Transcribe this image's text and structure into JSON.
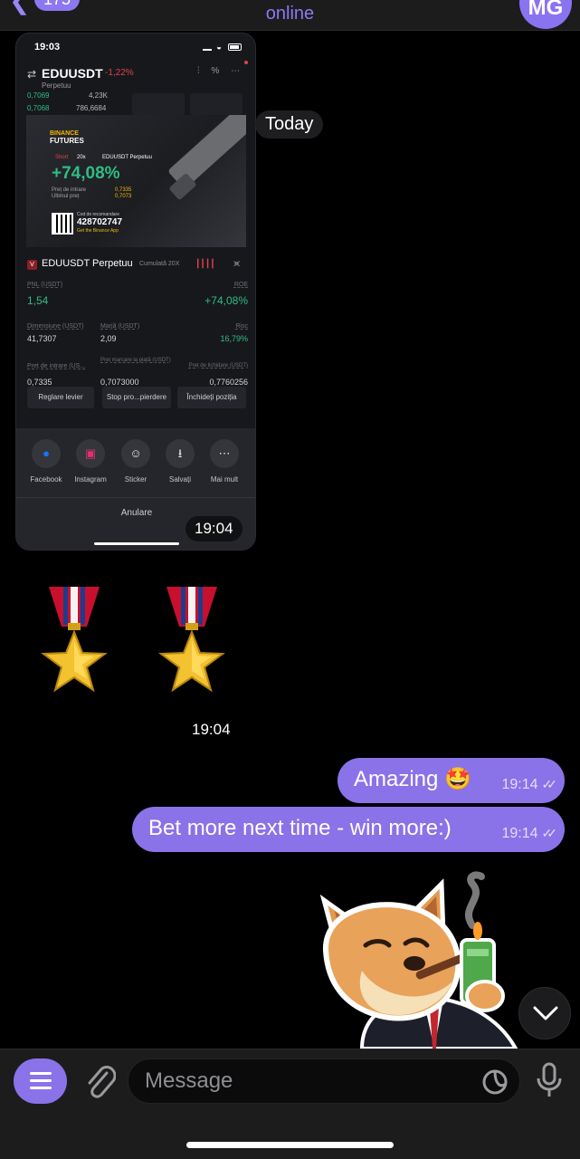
{
  "header": {
    "back_badge": "175",
    "status": "online",
    "avatar_initials": "MG"
  },
  "date_divider": "Today",
  "photo_message": {
    "time": "19:04",
    "screenshot": {
      "status_time": "19:03",
      "pair": "EDUUSDT",
      "change": "-1,22%",
      "contract": "Perpetuu",
      "book": {
        "price_1": "0,7069",
        "qty_1": "4,23K",
        "price_2": "0,7068",
        "qty_2": "786,6684"
      },
      "card": {
        "brand_line1": "BINANCE",
        "brand_line2": "FUTURES",
        "side": "Short",
        "leverage": "20x",
        "pair": "EDUUSDT Perpetuu",
        "roe": "+74,08%",
        "entry_label": "Preț de intrare",
        "last_label": "Ultimul preț",
        "entry_value": "0,7335",
        "last_value": "0,7073",
        "referral_label": "Cod de recomandare",
        "referral_code": "428702747",
        "app_text": "Get the Binance App"
      },
      "position": {
        "side_badge": "V",
        "title": "EDUUSDT Perpetuu",
        "mode": "Cumulată 20X",
        "pnl_label": "PNL (USDT)",
        "pnl_value": "1,54",
        "roe_label": "ROE",
        "roe_value": "+74,08%",
        "size_label": "Dimensiune (USDT)",
        "size_value": "41,7307",
        "margin_label": "Marjă (USDT)",
        "margin_value": "2,09",
        "risk_label": "Risc",
        "risk_value": "16,79%",
        "entry_label": "Preț de intrare (US...",
        "entry_value": "0,7335",
        "mark_label": "Preț marcare la piață (USDT)",
        "mark_value": "0,7073000",
        "liq_label": "Preț de lichidare (USDT)",
        "liq_value": "0,7760256"
      },
      "buttons": [
        "Reglare levier",
        "Stop pro...pierdere",
        "Închideți poziția"
      ],
      "share_items": [
        {
          "label": "Facebook",
          "icon": "facebook-icon"
        },
        {
          "label": "Instagram",
          "icon": "instagram-icon"
        },
        {
          "label": "Sticker",
          "icon": "sticker-icon"
        },
        {
          "label": "Salvați",
          "icon": "save-icon"
        },
        {
          "label": "Mai mult",
          "icon": "more-icon"
        }
      ],
      "cancel": "Anulare"
    }
  },
  "medals_message": {
    "time": "19:04",
    "count": 2
  },
  "outgoing": [
    {
      "text": "Amazing 🤩",
      "time": "19:14",
      "status": "read"
    },
    {
      "text": "Bet more next time - win more:)",
      "time": "19:14",
      "status": "read"
    }
  ],
  "input": {
    "placeholder": "Message"
  },
  "colors": {
    "accent": "#8a73e8",
    "bubble": "#8a73e8",
    "profit": "#2ebd85",
    "loss": "#e0424e"
  }
}
